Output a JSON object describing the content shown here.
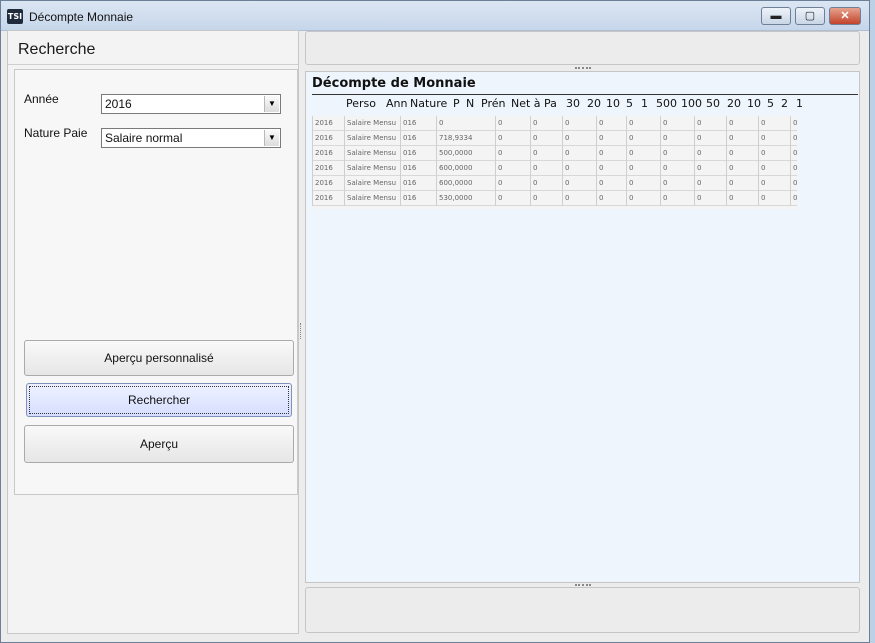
{
  "window": {
    "title": "Décompte Monnaie",
    "app_icon_text": "TSI",
    "min_glyph": "▬",
    "max_glyph": "▢",
    "close_glyph": "✕"
  },
  "left": {
    "title": "Recherche",
    "annee_label": "Année",
    "annee_value": "2016",
    "nature_label": "Nature Paie",
    "nature_value": "Salaire normal",
    "buttons": {
      "apercu_perso": "Aperçu personnalisé",
      "rechercher": "Rechercher",
      "apercu": "Aperçu"
    }
  },
  "report": {
    "title": "Décompte de Monnaie",
    "columns": [
      "Perso",
      "Ann",
      "Nature",
      "P",
      "N",
      "Prén",
      "Net à Pa",
      "30",
      "20",
      "10",
      "5",
      "1",
      "500",
      "100",
      "50",
      "20",
      "10",
      "5",
      "2",
      "1"
    ],
    "rows": [
      [
        "2016",
        "Salaire Mensu",
        "016",
        "0",
        "0",
        "0",
        "0",
        "0",
        "0",
        "0",
        "0",
        "0",
        "0",
        "0"
      ],
      [
        "2016",
        "Salaire Mensu",
        "016",
        "718,9334",
        "0",
        "0",
        "0",
        "0",
        "0",
        "0",
        "0",
        "0",
        "0",
        "0"
      ],
      [
        "2016",
        "Salaire Mensu",
        "016",
        "500,0000",
        "0",
        "0",
        "0",
        "0",
        "0",
        "0",
        "0",
        "0",
        "0",
        "0"
      ],
      [
        "2016",
        "Salaire Mensu",
        "016",
        "600,0000",
        "0",
        "0",
        "0",
        "0",
        "0",
        "0",
        "0",
        "0",
        "0",
        "0"
      ],
      [
        "2016",
        "Salaire Mensu",
        "016",
        "600,0000",
        "0",
        "0",
        "0",
        "0",
        "0",
        "0",
        "0",
        "0",
        "0",
        "0"
      ],
      [
        "2016",
        "Salaire Mensu",
        "016",
        "530,0000",
        "0",
        "0",
        "0",
        "0",
        "0",
        "0",
        "0",
        "0",
        "0",
        "0"
      ]
    ]
  }
}
